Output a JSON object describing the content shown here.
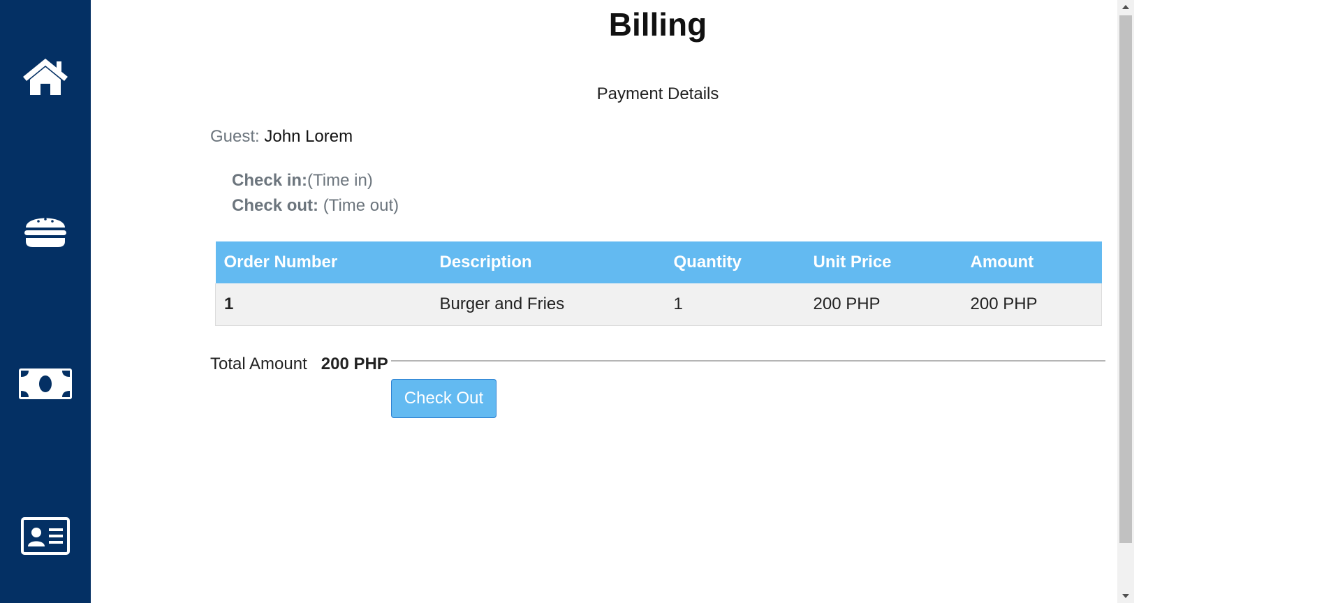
{
  "sidebar": {
    "items": [
      {
        "icon": "home-icon"
      },
      {
        "icon": "burger-icon"
      },
      {
        "icon": "money-bill-icon"
      },
      {
        "icon": "id-card-icon"
      }
    ],
    "background": "#043064"
  },
  "page": {
    "title": "Billing",
    "subtitle": "Payment Details"
  },
  "guest": {
    "label": "Guest:",
    "name": "John Lorem"
  },
  "stay": {
    "check_in_label": "Check in:",
    "check_in_value": "(Time in)",
    "check_out_label": "Check out:",
    "check_out_value": "(Time out)"
  },
  "orders": {
    "headers": [
      "Order Number",
      "Description",
      "Quantity",
      "Unit Price",
      "Amount"
    ],
    "rows": [
      [
        "1",
        "Burger and Fries",
        "1",
        "200 PHP",
        "200 PHP"
      ]
    ],
    "header_color": "#63baf1"
  },
  "total": {
    "label": "Total Amount",
    "value": "200 PHP"
  },
  "actions": {
    "checkout_label": "Check Out"
  }
}
